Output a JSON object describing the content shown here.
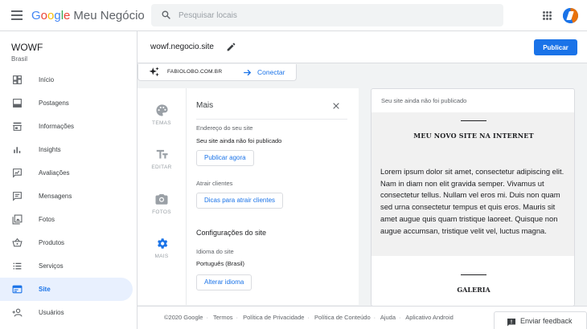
{
  "app": {
    "brand_letters": [
      "G",
      "o",
      "o",
      "g",
      "l",
      "e"
    ],
    "product": "Meu Negócio"
  },
  "search": {
    "placeholder": "Pesquisar locais"
  },
  "business": {
    "name": "WOWF",
    "location": "Brasil"
  },
  "sidebar": {
    "items": [
      {
        "label": "Início",
        "icon": "dashboard-icon"
      },
      {
        "label": "Postagens",
        "icon": "posts-icon"
      },
      {
        "label": "Informações",
        "icon": "store-icon"
      },
      {
        "label": "Insights",
        "icon": "insights-icon"
      },
      {
        "label": "Avaliações",
        "icon": "reviews-icon"
      },
      {
        "label": "Mensagens",
        "icon": "messages-icon"
      },
      {
        "label": "Fotos",
        "icon": "photos-icon"
      },
      {
        "label": "Produtos",
        "icon": "basket-icon"
      },
      {
        "label": "Serviços",
        "icon": "list-icon"
      },
      {
        "label": "Site",
        "icon": "web-icon",
        "active": true
      },
      {
        "label": "Usuários",
        "icon": "add-user-icon"
      }
    ]
  },
  "site_header": {
    "domain": "wowf.negocio.site",
    "publish_label": "Publicar"
  },
  "connect_bar": {
    "domain": "FABIOLOBO.COM.BR",
    "link_label": "Conectar"
  },
  "tools": [
    {
      "label": "TEMAS",
      "icon": "palette-icon"
    },
    {
      "label": "EDITAR",
      "icon": "text-format-icon"
    },
    {
      "label": "FOTOS",
      "icon": "camera-icon"
    },
    {
      "label": "MAIS",
      "icon": "settings-icon",
      "active": true
    }
  ],
  "panel": {
    "title": "Mais",
    "address_label": "Endereço do seu site",
    "address_status": "Seu site ainda não foi publicado",
    "publish_now_label": "Publicar agora",
    "attract_label": "Atrair clientes",
    "attract_button": "Dicas para atrair clientes",
    "settings_heading": "Configurações do site",
    "language_label": "Idioma do site",
    "language_value": "Português (Brasil)",
    "change_language_button": "Alterar idioma"
  },
  "preview": {
    "status": "Seu site ainda não foi publicado",
    "hero_title": "MEU NOVO SITE NA INTERNET",
    "hero_body": "Lorem ipsum dolor sit amet, consectetur adipiscing elit. Nam in diam non elit gravida semper. Vivamus ut consectetur tellus. Nullam vel eros mi. Duis non quam sed urna consectetur tempus et quis eros. Mauris sit amet augue quis quam tristique laoreet. Quisque non augue accumsan, tristique velit vel, luctus magna.",
    "gallery_title": "GALERIA"
  },
  "footer": {
    "links": [
      "©2020 Google",
      "Termos",
      "Política de Privacidade",
      "Política de Conteúdo",
      "Ajuda",
      "Aplicativo Android"
    ],
    "feedback_label": "Enviar feedback"
  },
  "colors": {
    "accent": "#1a73e8",
    "active_bg": "#e8f0fe",
    "brand_orange": "#e8710a"
  }
}
